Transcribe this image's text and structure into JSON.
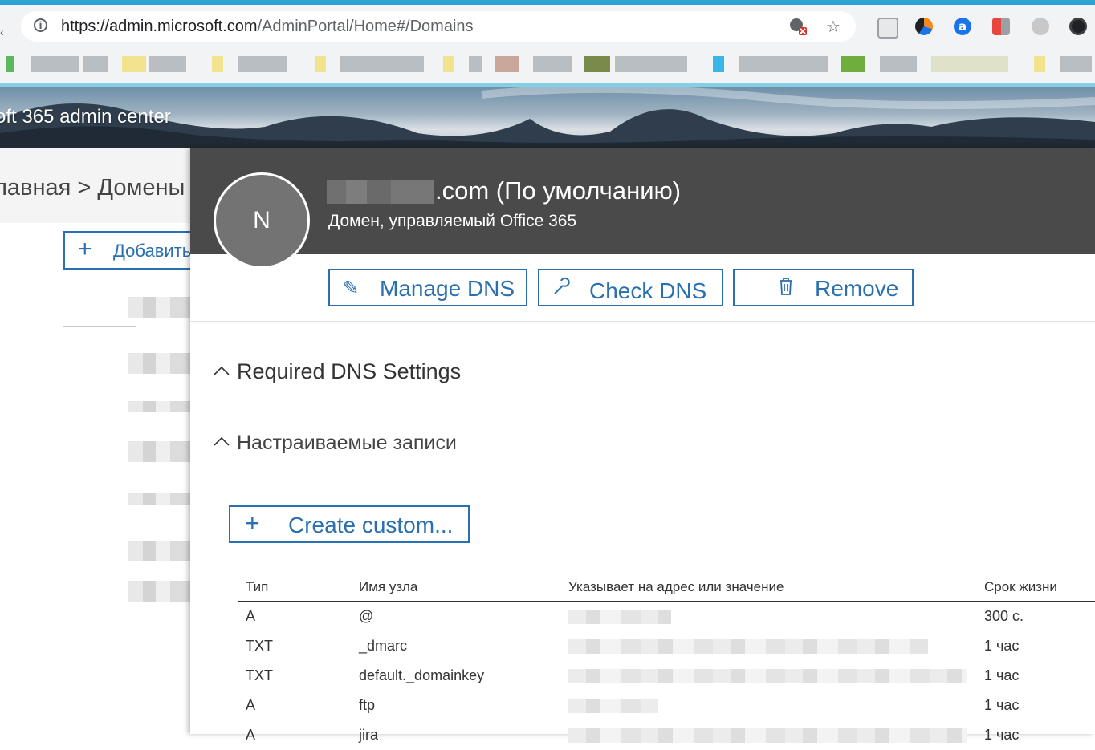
{
  "browser": {
    "url_host": "https://admin.microsoft.com",
    "url_path": "/AdminPortal/Home#/Domains"
  },
  "app": {
    "title": "oft 365 admin center"
  },
  "background_page": {
    "breadcrumb": "лавная > Домены",
    "add_button_label": "Добавить"
  },
  "panel": {
    "avatar_letter": "N",
    "domain_title": ".com (По умолчанию)",
    "domain_subtitle": "Домен, управляемый Office 365",
    "actions": [
      {
        "label": "Manage DNS",
        "icon": "pencil-icon"
      },
      {
        "label": "Check DNS",
        "icon": "wrench-icon"
      },
      {
        "label": "Remove",
        "icon": "trash-icon"
      }
    ],
    "sections": {
      "required": "Required DNS Settings",
      "custom": "Настраиваемые записи"
    },
    "create_custom_label": "Create custom...",
    "table": {
      "headers": [
        "Тип",
        "Имя узла",
        "Указывает на адрес или значение",
        "Срок жизни"
      ],
      "rows": [
        {
          "type": "A",
          "host": "@",
          "ttl": "300 с."
        },
        {
          "type": "TXT",
          "host": "_dmarc",
          "ttl": "1 час"
        },
        {
          "type": "TXT",
          "host": "default._domainkey",
          "ttl": "1 час"
        },
        {
          "type": "A",
          "host": "ftp",
          "ttl": "1 час"
        },
        {
          "type": "A",
          "host": "jira",
          "ttl": "1 час"
        }
      ]
    }
  },
  "colors": {
    "accent": "#2a6fb0",
    "header_bg": "#4a4a4a",
    "chrome_bg": "#f1f3f4"
  }
}
